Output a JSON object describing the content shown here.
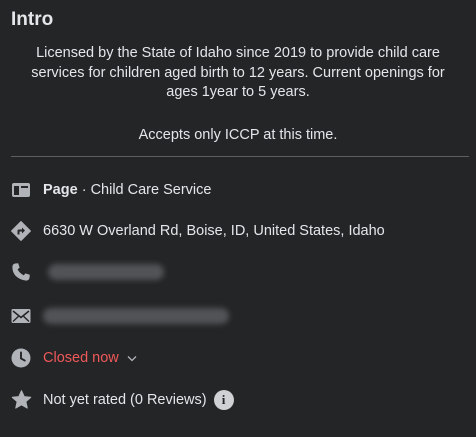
{
  "intro": {
    "title": "Intro",
    "bio_lines": [
      "Licensed by the State of Idaho since 2019 to provide child care",
      "services for children aged birth to 12 years. Current openings for",
      "ages 1year to 5 years."
    ],
    "note": "Accepts only ICCP at this time."
  },
  "details": {
    "page_label": "Page",
    "page_separator": " · ",
    "category": "Child Care Service",
    "address": "6630 W Overland Rd, Boise, ID, United States, Idaho",
    "hours_status": "Closed now",
    "rating": "Not yet rated (0 Reviews)",
    "info_glyph": "i"
  },
  "icons": {
    "page": "page-flag-icon",
    "address": "directions-icon",
    "phone": "phone-icon",
    "email": "envelope-icon",
    "hours": "clock-icon",
    "hours_toggle": "chevron-down-icon",
    "rating": "star-icon",
    "rating_info": "info-icon"
  },
  "colors": {
    "background": "#242526",
    "text": "#e4e6eb",
    "icon": "#b0b3b8",
    "closed": "#f0585a",
    "divider": "#5d5f62"
  }
}
